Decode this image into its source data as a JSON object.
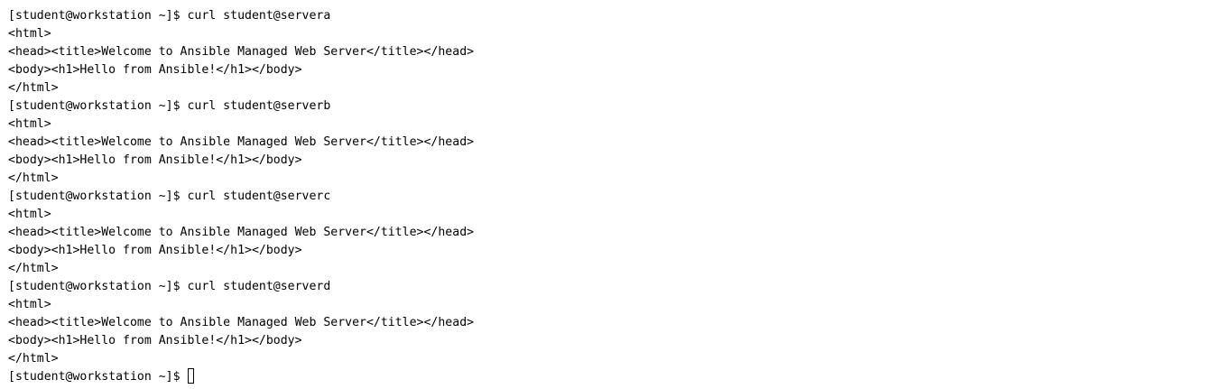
{
  "terminal": {
    "lines": [
      "[student@workstation ~]$ curl student@servera",
      "<html>",
      "<head><title>Welcome to Ansible Managed Web Server</title></head>",
      "<body><h1>Hello from Ansible!</h1></body>",
      "</html>",
      "[student@workstation ~]$ curl student@serverb",
      "<html>",
      "<head><title>Welcome to Ansible Managed Web Server</title></head>",
      "<body><h1>Hello from Ansible!</h1></body>",
      "</html>",
      "[student@workstation ~]$ curl student@serverc",
      "<html>",
      "<head><title>Welcome to Ansible Managed Web Server</title></head>",
      "<body><h1>Hello from Ansible!</h1></body>",
      "</html>",
      "[student@workstation ~]$ curl student@serverd",
      "<html>",
      "<head><title>Welcome to Ansible Managed Web Server</title></head>",
      "<body><h1>Hello from Ansible!</h1></body>",
      "</html>"
    ],
    "prompt": "[student@workstation ~]$"
  }
}
